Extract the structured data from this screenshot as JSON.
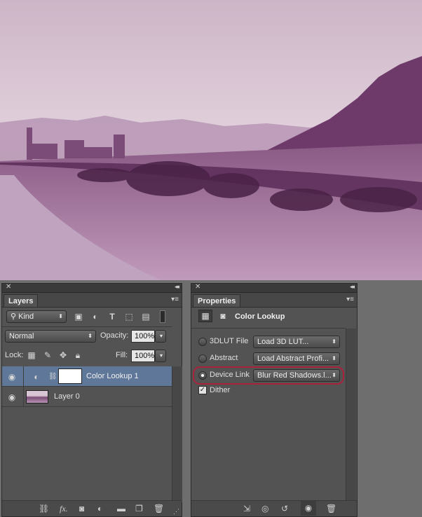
{
  "layers_panel": {
    "tab_label": "Layers",
    "filter": {
      "kind_label": "Kind"
    },
    "blend_mode": "Normal",
    "opacity_label": "Opacity:",
    "opacity_value": "100%",
    "lock_label": "Lock:",
    "fill_label": "Fill:",
    "fill_value": "100%",
    "layers": [
      {
        "name": "Color Lookup 1",
        "visible": true,
        "selected": true
      },
      {
        "name": "Layer 0",
        "visible": true,
        "selected": false
      }
    ]
  },
  "properties_panel": {
    "tab_label": "Properties",
    "header_title": "Color Lookup",
    "options": [
      {
        "label": "3DLUT File",
        "value": "Load 3D LUT...",
        "selected": false
      },
      {
        "label": "Abstract",
        "value": "Load Abstract Profi...",
        "selected": false
      },
      {
        "label": "Device Link",
        "value": "Blur Red Shadows.l...",
        "selected": true
      }
    ],
    "dither_label": "Dither",
    "dither_checked": true
  },
  "colors": {
    "panel_bg": "#535353",
    "selected_row": "#5f7799",
    "highlight_ring": "#a8233a"
  }
}
